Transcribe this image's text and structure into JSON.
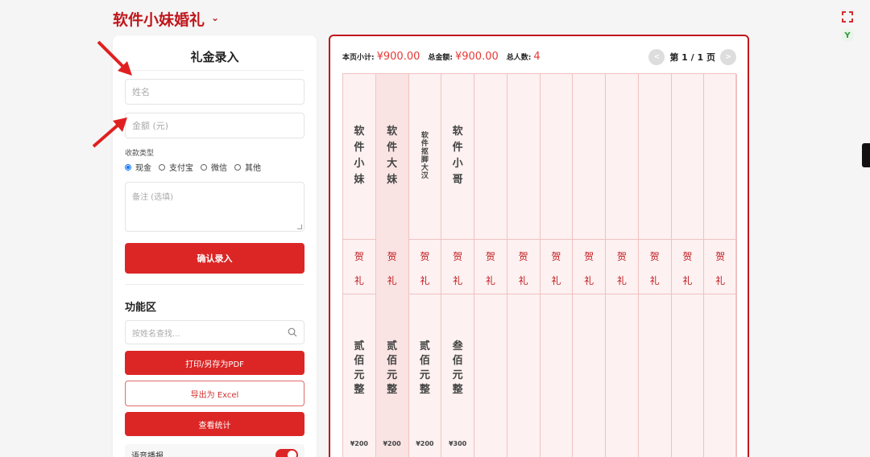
{
  "header": {
    "title": "软件小妹婚礼"
  },
  "form": {
    "title": "礼金录入",
    "name_placeholder": "姓名",
    "amount_placeholder": "金额 (元)",
    "type_label": "收款类型",
    "types": [
      "现金",
      "支付宝",
      "微信",
      "其他"
    ],
    "selected_type": "现金",
    "note_placeholder": "备注 (选填)",
    "confirm_label": "确认录入"
  },
  "functions": {
    "title": "功能区",
    "search_placeholder": "按姓名查找...",
    "print_label": "打印/另存为PDF",
    "export_label": "导出为 Excel",
    "stats_label": "查看统计",
    "voice_label": "语音播报",
    "voice_on": true
  },
  "summary": {
    "page_subtotal_label": "本页小计:",
    "page_subtotal": "¥900.00",
    "total_label": "总金额:",
    "total": "¥900.00",
    "count_label": "总人数:",
    "count": "4"
  },
  "pager": {
    "label": "第 1 / 1 页",
    "prev_icon": "chevron-left-icon",
    "next_icon": "chevron-right-icon"
  },
  "ledger": {
    "greeting": [
      "贺",
      "礼"
    ],
    "entries": [
      {
        "name": [
          "软",
          "件",
          "小",
          "妹"
        ],
        "amount_chinese": [
          "贰",
          "佰",
          "元",
          "整"
        ],
        "amount": "¥200"
      },
      {
        "name": [
          "软",
          "件",
          "大",
          "妹"
        ],
        "amount_chinese": [
          "贰",
          "佰",
          "元",
          "整"
        ],
        "amount": "¥200"
      },
      {
        "name": [
          "软",
          "件",
          "抠",
          "脚",
          "大",
          "汉"
        ],
        "amount_chinese": [
          "贰",
          "佰",
          "元",
          "整"
        ],
        "amount": "¥200"
      },
      {
        "name": [
          "软",
          "件",
          "小",
          "哥"
        ],
        "amount_chinese": [
          "叁",
          "佰",
          "元",
          "整"
        ],
        "amount": "¥300"
      }
    ],
    "total_columns": 12
  },
  "colors": {
    "accent": "#dc2626",
    "title": "#c0171c",
    "ledger_bg": "#fdf1f1",
    "ledger_line": "#f2c1c1"
  }
}
